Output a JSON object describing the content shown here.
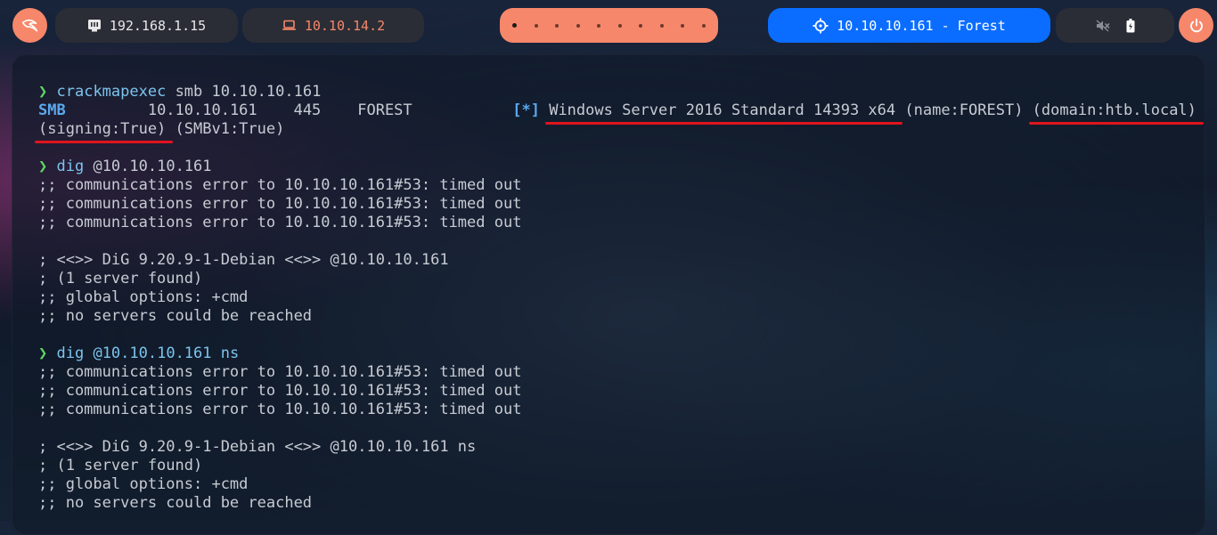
{
  "topbar": {
    "local_ip": "192.168.1.15",
    "vpn_ip": "10.10.14.2",
    "target": "10.10.10.161 - Forest",
    "workspaces": [
      "active",
      "",
      "",
      "",
      "",
      "",
      "",
      "",
      "",
      ""
    ],
    "icons": {
      "menu": "kali-dragon-icon",
      "local": "ethernet-icon",
      "vpn": "laptop-icon",
      "target": "crosshair-icon",
      "mute": "volume-mute-icon",
      "battery": "battery-charging-icon",
      "power": "power-icon"
    },
    "colors": {
      "accent": "#f7876a",
      "target_bg": "#0a6dff",
      "pill_bg": "#2a2d35"
    }
  },
  "terminal": {
    "prompt_symbol": "❯",
    "cmd1": {
      "name": "crackmapexec",
      "args": " smb 10.10.10.161"
    },
    "smb_line": {
      "proto": "SMB",
      "rest": "         10.10.10.161    445    FOREST           ",
      "star": "[*]",
      "os": "Windows Server 2016 Standard 14393 x64",
      "name": " (name:FOREST) ",
      "domain": "(domain:htb.local)"
    },
    "smb_line2": {
      "signing": "(signing:True)",
      "smbv1": " (SMBv1:True)"
    },
    "cmd2": {
      "name": "dig",
      "args": " @10.10.10.161"
    },
    "dig1_out": [
      ";; communications error to 10.10.10.161#53: timed out",
      ";; communications error to 10.10.10.161#53: timed out",
      ";; communications error to 10.10.10.161#53: timed out",
      "",
      "; <<>> DiG 9.20.9-1-Debian <<>> @10.10.10.161",
      "; (1 server found)",
      ";; global options: +cmd",
      ";; no servers could be reached"
    ],
    "cmd3": {
      "name": "dig",
      "args": " @10.10.10.161 ns"
    },
    "dig2_out": [
      ";; communications error to 10.10.10.161#53: timed out",
      ";; communications error to 10.10.10.161#53: timed out",
      ";; communications error to 10.10.10.161#53: timed out",
      "",
      "; <<>> DiG 9.20.9-1-Debian <<>> @10.10.10.161 ns",
      "; (1 server found)",
      ";; global options: +cmd",
      ";; no servers could be reached"
    ]
  }
}
